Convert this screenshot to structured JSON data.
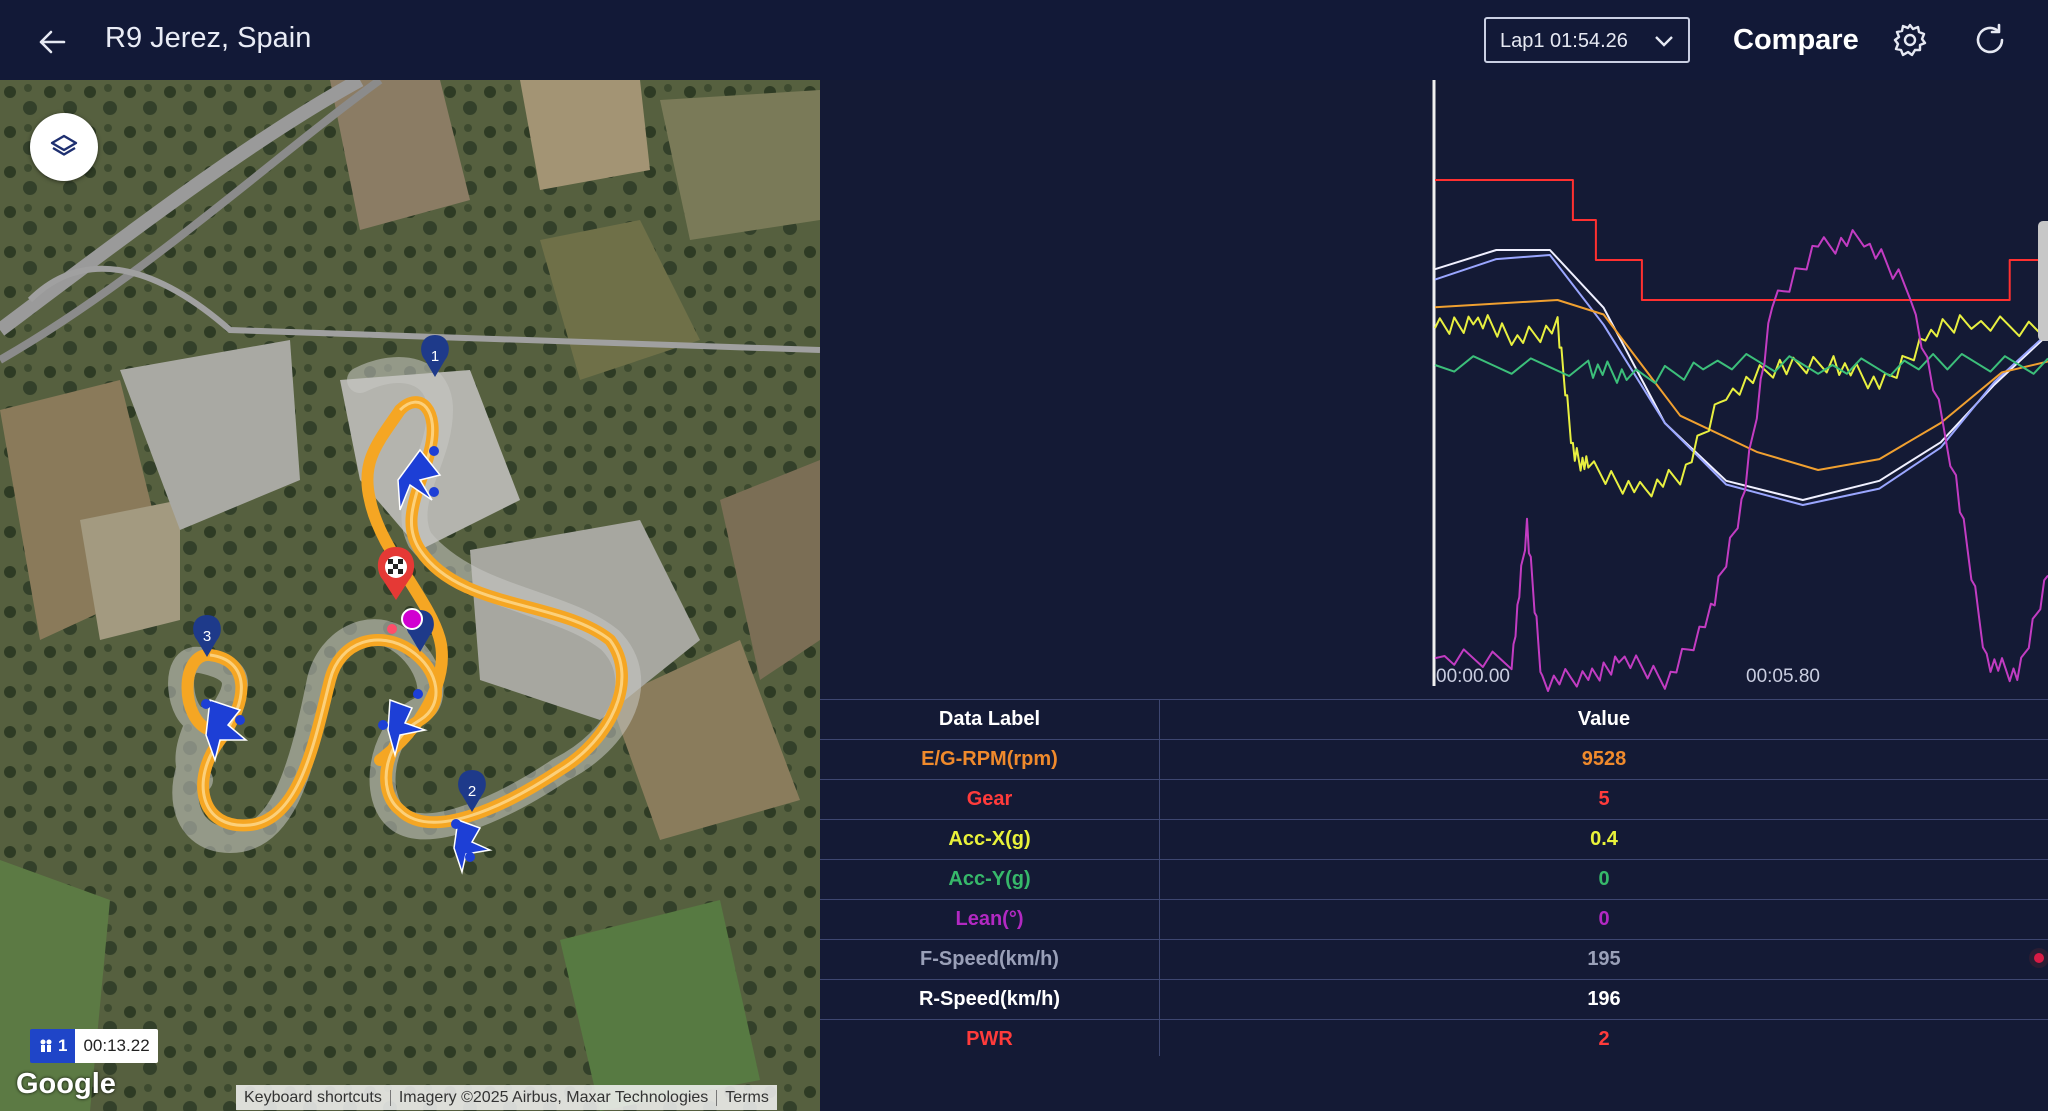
{
  "header": {
    "title": "R9 Jerez, Spain",
    "lap_selector": "Lap1 01:54.26",
    "compare_label": "Compare",
    "icons": [
      "arrow-left-icon",
      "chevron-down-icon",
      "gear-icon",
      "refresh-icon"
    ]
  },
  "map": {
    "markers": [
      "1",
      "2",
      "3"
    ],
    "lap_badge": {
      "lap": "1",
      "time": "00:13.22"
    },
    "google": "Google",
    "footer": {
      "shortcuts": "Keyboard shortcuts",
      "imagery": "Imagery ©2025 Airbus, Maxar Technologies",
      "terms": "Terms"
    },
    "colors": {
      "track": "#f5a623",
      "marker": "#1e3a8a",
      "finish": "#e53935",
      "cursor": "#d100d1"
    }
  },
  "chart": {
    "x_ticks": [
      "00:00.00",
      "00:05.80"
    ]
  },
  "chart_data": {
    "type": "line",
    "x_domain_seconds": [
      0,
      8.0
    ],
    "series": [
      {
        "color": "#ff3030",
        "points": [
          [
            0,
            4
          ],
          [
            1.8,
            4
          ],
          [
            1.8,
            3
          ],
          [
            2.1,
            3
          ],
          [
            2.1,
            2
          ],
          [
            2.7,
            2
          ],
          [
            2.7,
            1
          ],
          [
            7.5,
            1
          ],
          [
            7.5,
            2
          ],
          [
            8,
            2
          ]
        ]
      },
      {
        "color": "#f0f0ff",
        "points": [
          [
            0,
            0.95
          ],
          [
            0.8,
            1.0
          ],
          [
            1.5,
            1.0
          ],
          [
            2.2,
            0.85
          ],
          [
            3.0,
            0.55
          ],
          [
            3.8,
            0.4
          ],
          [
            4.8,
            0.35
          ],
          [
            5.8,
            0.4
          ],
          [
            6.6,
            0.5
          ],
          [
            7.3,
            0.65
          ],
          [
            8,
            0.78
          ]
        ]
      },
      {
        "color": "#9aa6ff",
        "points": [
          [
            0,
            0.93
          ],
          [
            0.8,
            0.98
          ],
          [
            1.5,
            0.99
          ],
          [
            2.2,
            0.82
          ],
          [
            3.0,
            0.58
          ],
          [
            3.8,
            0.43
          ],
          [
            4.8,
            0.38
          ],
          [
            5.8,
            0.42
          ],
          [
            6.6,
            0.52
          ],
          [
            7.3,
            0.68
          ],
          [
            8,
            0.8
          ]
        ]
      },
      {
        "color": "#f0a030",
        "points": [
          [
            0,
            0.9
          ],
          [
            1.6,
            0.92
          ],
          [
            2.2,
            0.88
          ],
          [
            3.2,
            0.6
          ],
          [
            4.2,
            0.5
          ],
          [
            5.0,
            0.45
          ],
          [
            5.8,
            0.48
          ],
          [
            6.6,
            0.58
          ],
          [
            7.4,
            0.72
          ],
          [
            8,
            0.75
          ]
        ]
      },
      {
        "color": "#e8f040",
        "points": [
          [
            0,
            0.7
          ],
          [
            0.5,
            0.72
          ],
          [
            1.0,
            0.68
          ],
          [
            1.6,
            0.7
          ],
          [
            1.8,
            0.4
          ],
          [
            2.0,
            0.35
          ],
          [
            2.6,
            0.3
          ],
          [
            3.2,
            0.33
          ],
          [
            3.8,
            0.55
          ],
          [
            4.5,
            0.6
          ],
          [
            5.2,
            0.62
          ],
          [
            5.8,
            0.55
          ],
          [
            6.4,
            0.68
          ],
          [
            7.0,
            0.72
          ],
          [
            8,
            0.7
          ]
        ]
      },
      {
        "color": "#3cbf7a",
        "points": [
          [
            0,
            0.55
          ],
          [
            2.0,
            0.55
          ],
          [
            2.5,
            0.52
          ],
          [
            3.5,
            0.55
          ],
          [
            5.0,
            0.55
          ],
          [
            6.5,
            0.55
          ],
          [
            8,
            0.55
          ]
        ]
      },
      {
        "color": "#c23cc2",
        "points": [
          [
            0,
            -40
          ],
          [
            1.0,
            -40
          ],
          [
            1.2,
            -10
          ],
          [
            1.4,
            -45
          ],
          [
            2.0,
            -45
          ],
          [
            2.4,
            -40
          ],
          [
            3.0,
            -45
          ],
          [
            3.6,
            -30
          ],
          [
            4.0,
            -5
          ],
          [
            4.4,
            40
          ],
          [
            5.0,
            55
          ],
          [
            5.6,
            56
          ],
          [
            6.2,
            45
          ],
          [
            6.8,
            0
          ],
          [
            7.2,
            -40
          ],
          [
            7.6,
            -45
          ],
          [
            8,
            -20
          ]
        ]
      }
    ]
  },
  "table": {
    "headers": {
      "label": "Data Label",
      "value": "Value"
    },
    "rows": [
      {
        "label": "E/G-RPM(rpm)",
        "value": "9528",
        "color": "#f08a2c"
      },
      {
        "label": "Gear",
        "value": "5",
        "color": "#ff3b3b"
      },
      {
        "label": "Acc-X(g)",
        "value": "0.4",
        "color": "#e9f23a"
      },
      {
        "label": "Acc-Y(g)",
        "value": "0",
        "color": "#37b86a"
      },
      {
        "label": "Lean(°)",
        "value": "0",
        "color": "#b229c2"
      },
      {
        "label": "F-Speed(km/h)",
        "value": "195",
        "color": "#9aa0b8"
      },
      {
        "label": "R-Speed(km/h)",
        "value": "196",
        "color": "#ffffff"
      },
      {
        "label": "PWR",
        "value": "2",
        "color": "#ff3b3b"
      }
    ]
  }
}
